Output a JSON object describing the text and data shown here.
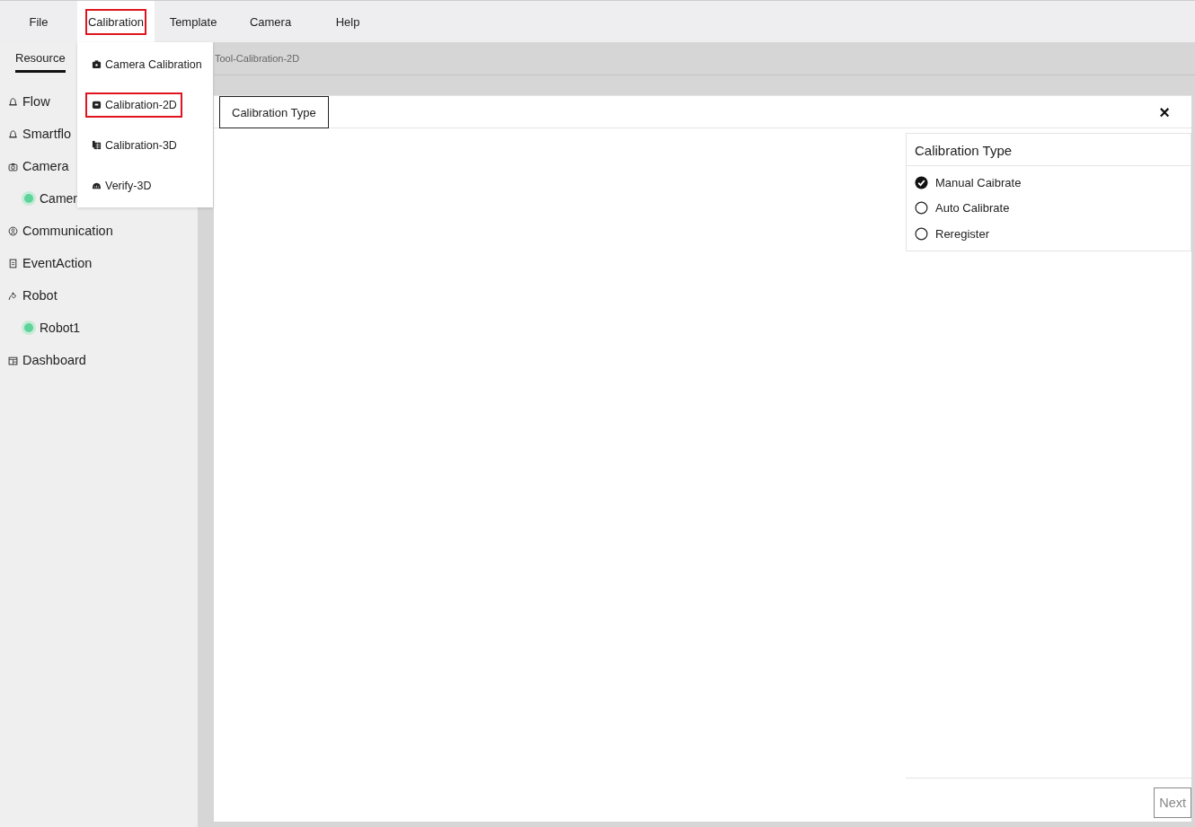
{
  "menu_bar": [
    {
      "label": "File",
      "open": false,
      "highlighted": false
    },
    {
      "label": "Calibration",
      "open": true,
      "highlighted": true
    },
    {
      "label": "Template",
      "open": false,
      "highlighted": false
    },
    {
      "label": "Camera",
      "open": false,
      "highlighted": false
    },
    {
      "label": "Help",
      "open": false,
      "highlighted": false
    }
  ],
  "dropdown": [
    {
      "label": "Camera Calibration",
      "highlighted": false
    },
    {
      "label": "Calibration-2D",
      "highlighted": true
    },
    {
      "label": "Calibration-3D",
      "highlighted": false
    },
    {
      "label": "Verify-3D",
      "highlighted": false
    }
  ],
  "sidebar": {
    "tabs": [
      {
        "label": "Resource",
        "selected": true
      }
    ],
    "items": [
      {
        "label": "Flow"
      },
      {
        "label": "Smartflo"
      },
      {
        "label": "Camera",
        "children": [
          {
            "label": "Camer",
            "color": "#5ed39a"
          }
        ]
      },
      {
        "label": "Communication"
      },
      {
        "label": "EventAction"
      },
      {
        "label": "Robot",
        "children": [
          {
            "label": "Robot1",
            "color": "#5ed39a"
          }
        ]
      },
      {
        "label": "Dashboard"
      }
    ]
  },
  "breadcrumb": "Tool-Calibration-2D",
  "panel": {
    "tabs": [
      {
        "label": "Calibration Type"
      }
    ],
    "close": "×",
    "card": {
      "title": "Calibration Type",
      "options": [
        {
          "label": "Manual Caibrate",
          "selected": true
        },
        {
          "label": "Auto Calibrate",
          "selected": false
        },
        {
          "label": "Reregister",
          "selected": false
        }
      ]
    },
    "next_button": {
      "label": "Next",
      "disabled": true
    }
  }
}
